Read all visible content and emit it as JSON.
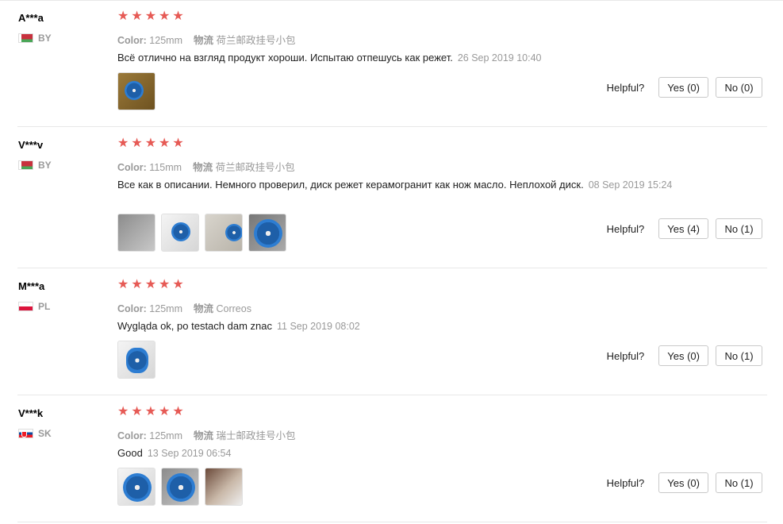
{
  "labels": {
    "color": "Color:",
    "logistics": "物流",
    "helpful": "Helpful?"
  },
  "reviews": [
    {
      "user": "A***a",
      "country": "BY",
      "stars": 5,
      "color": "125mm",
      "logistics": "荷兰邮政挂号小包",
      "text": "Всё отлично на взгляд продукт хороши. Испытаю отпешусь как режет.",
      "date": "26 Sep 2019 10:40",
      "photos": [
        "t-brown"
      ],
      "yes": "Yes (0)",
      "no": "No (0)"
    },
    {
      "user": "V***v",
      "country": "BY",
      "stars": 5,
      "color": "115mm",
      "logistics": "荷兰邮政挂号小包",
      "text": "Все как в описании. Немного проверил, диск режет керамогранит как нож масло. Неплохой диск.",
      "date": "08 Sep 2019 15:24",
      "photos": [
        "t-grey",
        "t-white",
        "t-box",
        "t-dark"
      ],
      "yes": "Yes (4)",
      "no": "No (1)"
    },
    {
      "user": "M***a",
      "country": "PL",
      "stars": 5,
      "color": "125mm",
      "logistics": "Correos",
      "text": "Wygląda ok, po testach dam znac",
      "date": "11 Sep 2019 08:02",
      "photos": [
        "t-white"
      ],
      "yes": "Yes (0)",
      "no": "No (1)"
    },
    {
      "user": "V***k",
      "country": "SK",
      "stars": 5,
      "color": "125mm",
      "logistics": "瑞士邮政挂号小包",
      "text": "Good",
      "date": "13 Sep 2019 06:54",
      "photos": [
        "t-white",
        "t-grey",
        "t-hand"
      ],
      "yes": "Yes (0)",
      "no": "No (1)"
    }
  ]
}
